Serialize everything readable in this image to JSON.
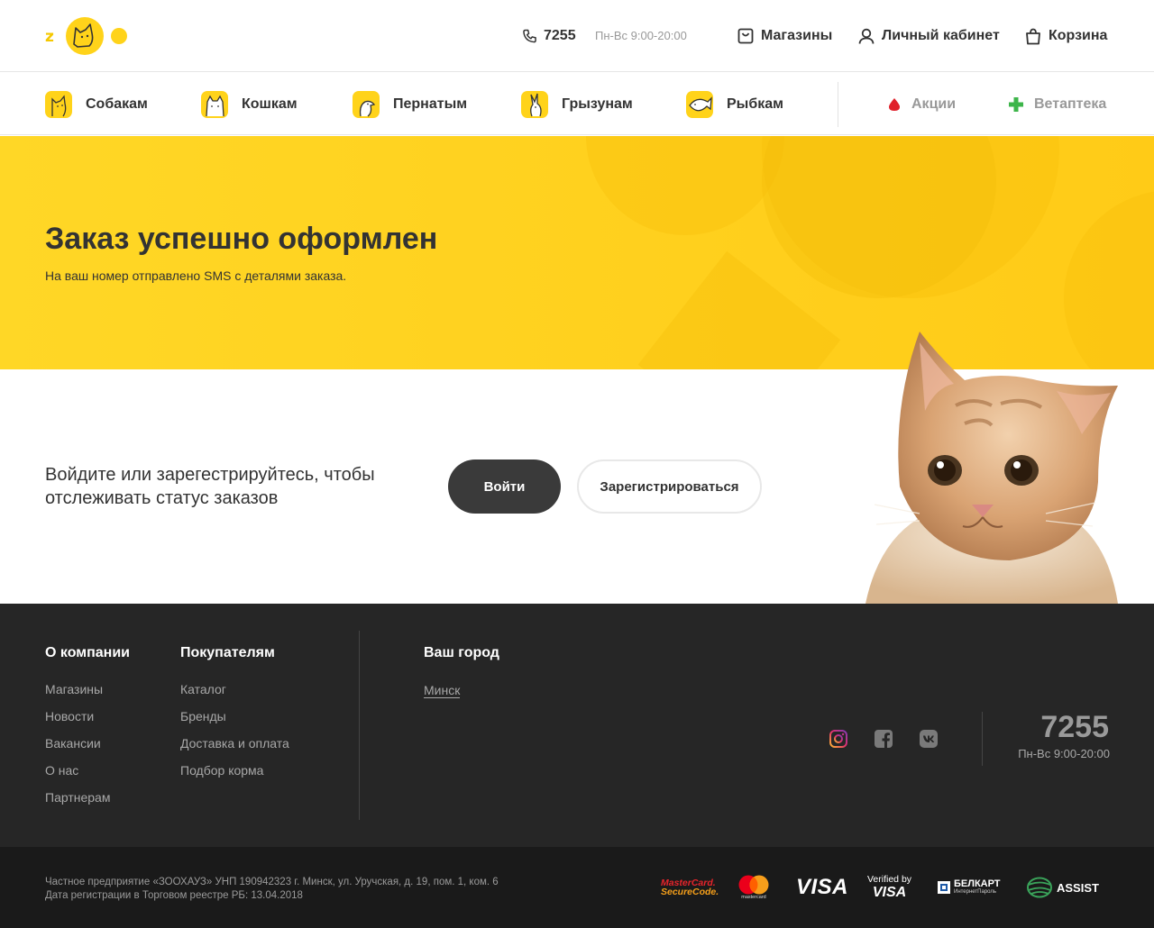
{
  "header": {
    "phone": "7255",
    "hours": "Пн-Вс 9:00-20:00",
    "stores": "Магазины",
    "account": "Личный кабинет",
    "cart": "Корзина"
  },
  "nav": {
    "dogs": "Собакам",
    "cats": "Кошкам",
    "birds": "Пернатым",
    "rodents": "Грызунам",
    "fish": "Рыбкам",
    "sales": "Акции",
    "vet": "Ветаптека"
  },
  "hero": {
    "title": "Заказ успешно оформлен",
    "subtitle": "На ваш номер отправлено SMS с деталями заказа."
  },
  "auth": {
    "prompt": "Войдите или зарегестрируйтесь, чтобы отслеживать статус заказов",
    "login": "Войти",
    "register": "Зарегистрироваться"
  },
  "footer": {
    "company_title": "О компании",
    "company_links": [
      "Магазины",
      "Новости",
      "Вакансии",
      "О нас",
      "Партнерам"
    ],
    "buyers_title": "Покупателям",
    "buyers_links": [
      "Каталог",
      "Бренды",
      "Доставка и оплата",
      "Подбор корма"
    ],
    "city_title": "Ваш город",
    "city": "Минск",
    "phone": "7255",
    "hours": "Пн-Вс 9:00-20:00"
  },
  "legal": {
    "line1": "Частное предприятие «ЗООХАУЗ» УНП 190942323 г. Минск, ул. Уручская, д. 19, пом. 1, ком. 6",
    "line2": "Дата регистрации в Торговом реестре РБ: 13.04.2018"
  },
  "payments": {
    "mc_secure_1": "MasterCard.",
    "mc_secure_2": "SecureCode.",
    "mastercard": "mastercard",
    "visa": "VISA",
    "verified_1": "Verified by",
    "verified_2": "VISA",
    "belkart_1": "БЕЛКАРТ",
    "belkart_2": "ИнтернетПароль",
    "assist": "ASSIST"
  },
  "colors": {
    "brand_yellow": "#FFD31A",
    "dark": "#333333",
    "footer_bg": "#262626",
    "bottom_bg": "#1A1A1A",
    "sales_red": "#E0202A",
    "vet_green": "#3DB54A"
  },
  "icons": {
    "logo": "zoo-logo-dog",
    "phone": "phone-icon",
    "stores": "shopping-bag-icon",
    "account": "user-icon",
    "cart": "cart-bag-icon",
    "sales": "drop-icon",
    "vet": "cross-icon",
    "instagram": "instagram-icon",
    "facebook": "facebook-icon",
    "vk": "vk-icon"
  }
}
